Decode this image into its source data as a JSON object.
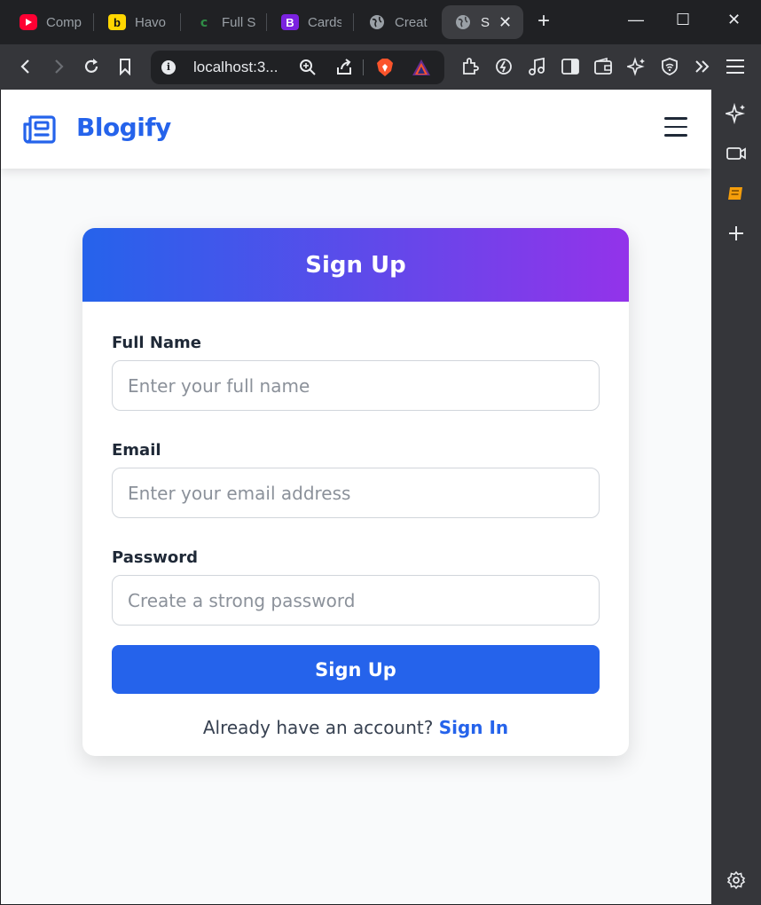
{
  "browser": {
    "tabs": [
      {
        "label": "Comp",
        "icon": "youtube-icon",
        "color": "#ff0000"
      },
      {
        "label": "Havo",
        "icon": "b-logo-icon",
        "color": "#ffd600"
      },
      {
        "label": "Full S",
        "icon": "geeksforgeeks-icon",
        "color": "#2f8d46"
      },
      {
        "label": "Cards",
        "icon": "bootstrap-icon",
        "color": "#7b22e0"
      },
      {
        "label": "Creat",
        "icon": "globe-icon",
        "color": "#9aa0a6"
      },
      {
        "label": "S",
        "icon": "globe-icon",
        "color": "#9aa0a6"
      }
    ],
    "new_tab": "+",
    "url": "localhost:3..."
  },
  "navbar": {
    "brand": "Blogify",
    "brand_color": "#2563eb"
  },
  "signup": {
    "title": "Sign Up",
    "gradient": [
      "#2563eb",
      "#9333ea"
    ],
    "fields": {
      "full_name": {
        "label": "Full Name",
        "placeholder": "Enter your full name",
        "value": ""
      },
      "email": {
        "label": "Email",
        "placeholder": "Enter your email address",
        "value": ""
      },
      "password": {
        "label": "Password",
        "placeholder": "Create a strong password",
        "value": ""
      }
    },
    "submit_label": "Sign Up",
    "footer_text": "Already have an account?",
    "signin_link": "Sign In"
  }
}
